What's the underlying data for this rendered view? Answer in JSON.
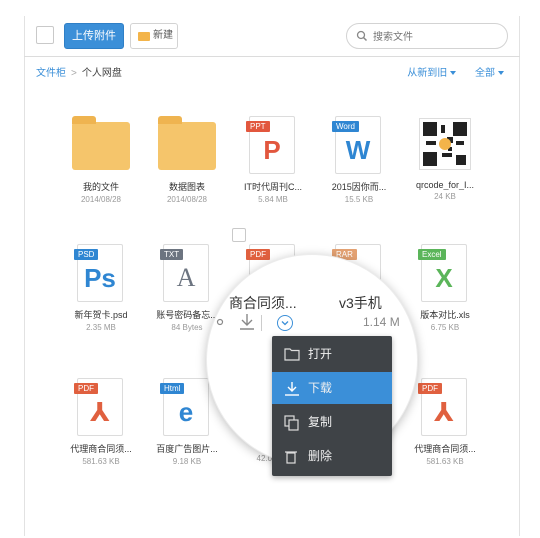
{
  "toolbar": {
    "upload_label": "上传附件",
    "new_label": "新建",
    "search_placeholder": "搜索文件"
  },
  "breadcrumb": {
    "root": "文件柜",
    "current": "个人网盘"
  },
  "sort": {
    "order_label": "从新到旧",
    "filter_label": "全部"
  },
  "files": [
    {
      "name": "我的文件",
      "meta": "2014/08/28",
      "kind": "folder"
    },
    {
      "name": "数据图表",
      "meta": "2014/08/28",
      "kind": "folder"
    },
    {
      "name": "IT时代周刊C...",
      "meta": "5.84 MB",
      "kind": "ppt",
      "tag": "PPT",
      "glyph": "P"
    },
    {
      "name": "2015因你而...",
      "meta": "15.5 KB",
      "kind": "word",
      "tag": "Word",
      "glyph": "W"
    },
    {
      "name": "qrcode_for_I...",
      "meta": "24 KB",
      "kind": "qr"
    },
    {
      "name": "新年贺卡.psd",
      "meta": "2.35 MB",
      "kind": "psd",
      "tag": "PSD",
      "glyph": "Ps"
    },
    {
      "name": "账号密码备忘...",
      "meta": "84 Bytes",
      "kind": "txt",
      "tag": "TXT",
      "glyph": "A"
    },
    {
      "name": "",
      "meta": "",
      "kind": "pdf",
      "tag": "PDF",
      "glyph": ""
    },
    {
      "name": "",
      "meta": "",
      "kind": "rar",
      "tag": "RAR",
      "glyph": ""
    },
    {
      "name": "版本对比.xls",
      "meta": "6.75 KB",
      "kind": "excel",
      "tag": "Excel",
      "glyph": "X"
    },
    {
      "name": "代理商合同须...",
      "meta": "581.63 KB",
      "kind": "pdf",
      "tag": "PDF",
      "glyph": "⅄"
    },
    {
      "name": "百度广告图片...",
      "meta": "9.18 KB",
      "kind": "html",
      "tag": "Html",
      "glyph": "e"
    },
    {
      "name": "130x...",
      "meta": "42.02 KB",
      "kind": "jpeg",
      "tag": "JPEG",
      "glyph": ""
    },
    {
      "name": "...于分...",
      "meta": "...KB",
      "kind": "doc",
      "tag": "",
      "glyph": ""
    },
    {
      "name": "代理商合同须...",
      "meta": "581.63 KB",
      "kind": "pdf",
      "tag": "PDF",
      "glyph": "⅄"
    }
  ],
  "lens": {
    "name_a": "商合同须...",
    "name_b": "v3手机",
    "size_b": "1.14 M",
    "ellipsis": "o"
  },
  "context_menu": [
    {
      "label": "打开",
      "icon": "folder-open-icon",
      "active": false
    },
    {
      "label": "下载",
      "icon": "download-icon",
      "active": true
    },
    {
      "label": "复制",
      "icon": "copy-icon",
      "active": false
    },
    {
      "label": "删除",
      "icon": "trash-icon",
      "active": false
    }
  ],
  "colors": {
    "accent": "#3b8fd8",
    "ppt": "#e2573e",
    "word": "#2f86d2",
    "psd": "#2f86d2",
    "txt": "#6c7480",
    "pdf": "#e0603f",
    "rar": "#e3a172",
    "excel": "#5bb55a",
    "html": "#2f86d2",
    "jpeg": "#f3b44a",
    "folder": "#f5c56b",
    "menu_bg": "#3f4347"
  }
}
